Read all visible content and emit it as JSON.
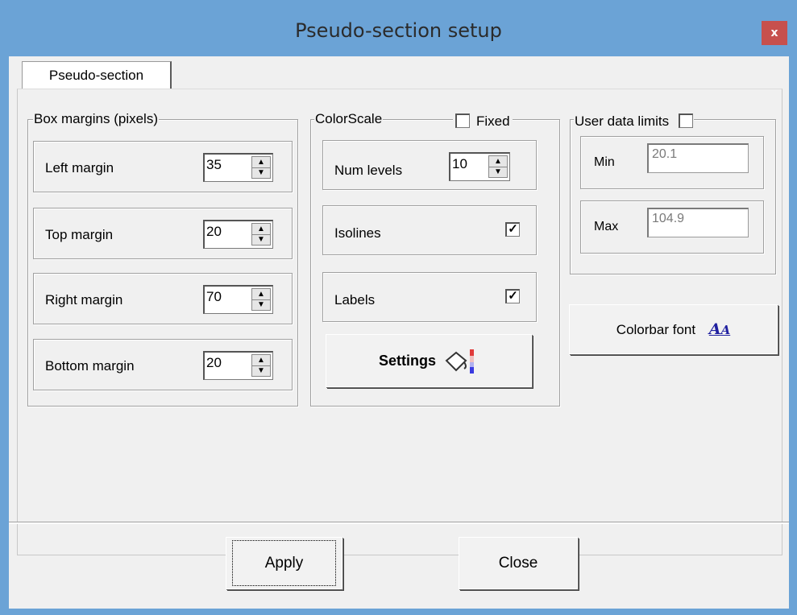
{
  "window": {
    "title": "Pseudo-section setup",
    "close_glyph": "x"
  },
  "tabs": [
    {
      "label": "Pseudo-section",
      "active": true
    }
  ],
  "box_margins": {
    "legend": "Box margins (pixels)",
    "rows": [
      {
        "label": "Left margin",
        "value": "35"
      },
      {
        "label": "Top margin",
        "value": "20"
      },
      {
        "label": "Right margin",
        "value": "70"
      },
      {
        "label": "Bottom margin",
        "value": "20"
      }
    ]
  },
  "colorscale": {
    "legend": "ColorScale",
    "fixed_label": "Fixed",
    "fixed_checked": false,
    "num_levels_label": "Num levels",
    "num_levels_value": "10",
    "isolines_label": "Isolines",
    "isolines_checked": true,
    "labels_label": "Labels",
    "labels_checked": true,
    "settings_label": "Settings"
  },
  "user_data_limits": {
    "legend": "User data limits",
    "enabled": false,
    "min_label": "Min",
    "min_value": "20.1",
    "max_label": "Max",
    "max_value": "104.9"
  },
  "colorbar_font_label": "Colorbar font",
  "footer": {
    "apply_label": "Apply",
    "close_label": "Close"
  },
  "colors": {
    "frame": "#6ba3d6",
    "close_button": "#c7504d",
    "dialog_bg": "#f0f0f0"
  },
  "icons": {
    "close": "close-icon",
    "spin": "spinner-arrows-icon",
    "settings": "paint-bucket-colorbar-icon",
    "font": "font-aa-icon"
  }
}
